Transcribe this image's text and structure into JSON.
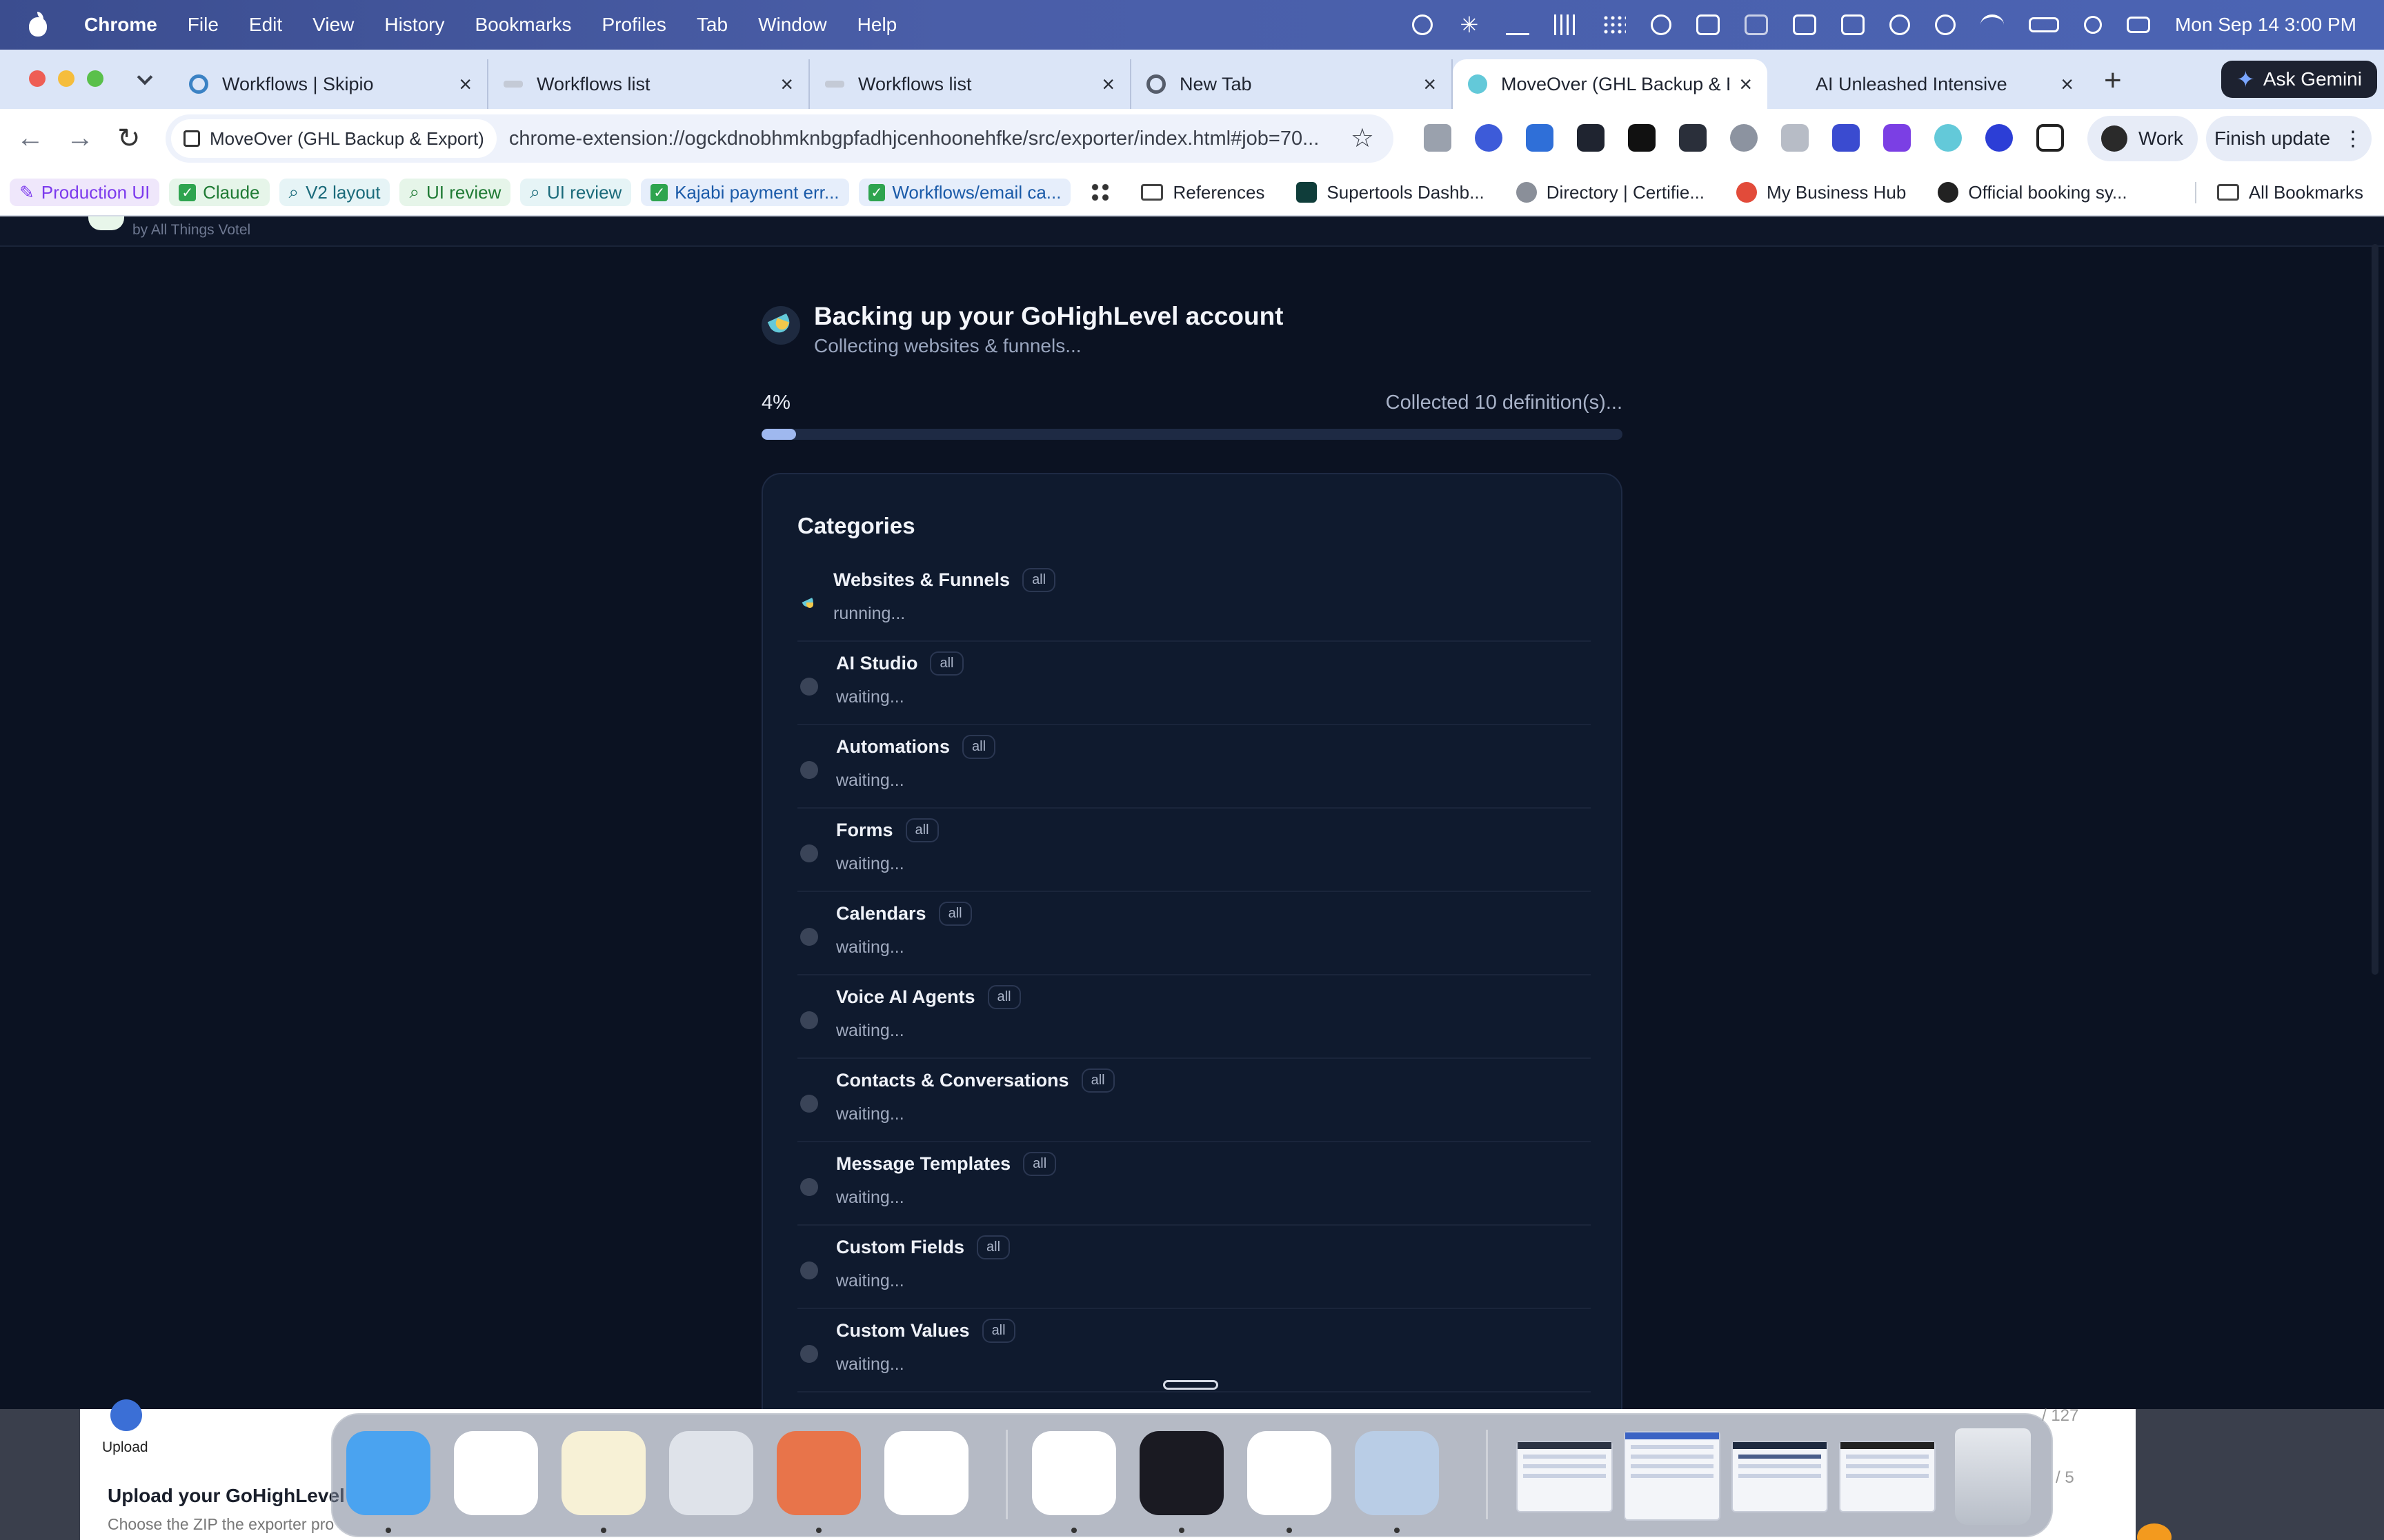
{
  "menubar": {
    "app_name": "Chrome",
    "items": [
      "File",
      "Edit",
      "View",
      "History",
      "Bookmarks",
      "Profiles",
      "Tab",
      "Window",
      "Help"
    ],
    "clock": "Mon Sep 14  3:00 PM"
  },
  "tabs": [
    {
      "title": "Workflows | Skipio",
      "favicon_color": "#3b82c4",
      "active": false
    },
    {
      "title": "Workflows list",
      "favicon_color": "#9aa3b5",
      "active": false
    },
    {
      "title": "Workflows list",
      "favicon_color": "#9aa3b5",
      "active": false
    },
    {
      "title": "New Tab",
      "favicon_color": "#555c6a",
      "active": false
    },
    {
      "title": "MoveOver (GHL Backup & E",
      "favicon_color": "#63c9d9",
      "active": true
    },
    {
      "title": "AI Unleashed Intensive",
      "favicon_color": "#ffffff",
      "active": false
    }
  ],
  "gemini_label": "Ask Gemini",
  "omnibox": {
    "chip": "MoveOver (GHL Backup & Export)",
    "url": "chrome-extension://ogckdnobhmknbgpfadhjcenhoonehfke/src/exporter/index.html#job=70..."
  },
  "profile_label": "Work",
  "update_label": "Finish update",
  "bookmarks": {
    "pills": [
      {
        "label": "Production UI",
        "icon": "pencil-icon",
        "color": "#7c3aed",
        "bg": "#efe7fb"
      },
      {
        "label": "Claude",
        "icon": "check-icon",
        "color": "#1f7a34",
        "bg": "#e6f5e9"
      },
      {
        "label": "V2 layout",
        "icon": "search-icon",
        "color": "#1a6a7a",
        "bg": "#e6f4f6"
      },
      {
        "label": "UI review",
        "icon": "search-icon",
        "color": "#1f7a34",
        "bg": "#e6f5e9"
      },
      {
        "label": "UI review",
        "icon": "search-icon",
        "color": "#1a6a7a",
        "bg": "#e6f4f6"
      },
      {
        "label": "Kajabi payment err...",
        "icon": "check-icon",
        "color": "#1a5aa8",
        "bg": "#e6eefb"
      },
      {
        "label": "Workflows/email ca...",
        "icon": "check-icon",
        "color": "#1a5aa8",
        "bg": "#e6eefb"
      }
    ],
    "plain": [
      {
        "label": "References",
        "icon": "folder-icon"
      },
      {
        "label": "Supertools Dashb...",
        "icon": "shield-icon"
      },
      {
        "label": "Directory | Certifie...",
        "icon": "person-icon"
      },
      {
        "label": "My Business Hub",
        "icon": "location-pin-icon"
      },
      {
        "label": "Official booking sy...",
        "icon": "globe-icon"
      }
    ],
    "all_bookmarks": "All Bookmarks"
  },
  "page": {
    "brand_byline": "by All Things Votel",
    "title": "Backing up your GoHighLevel account",
    "subtitle": "Collecting websites & funnels...",
    "progress_text": "4%",
    "progress_value": 0.04,
    "progress_status": "Collected 10 definition(s)...",
    "categories_heading": "Categories",
    "categories": [
      {
        "name": "Websites & Funnels",
        "badge": "all",
        "state": "running...",
        "running": true
      },
      {
        "name": "AI Studio",
        "badge": "all",
        "state": "waiting...",
        "running": false
      },
      {
        "name": "Automations",
        "badge": "all",
        "state": "waiting...",
        "running": false
      },
      {
        "name": "Forms",
        "badge": "all",
        "state": "waiting...",
        "running": false
      },
      {
        "name": "Calendars",
        "badge": "all",
        "state": "waiting...",
        "running": false
      },
      {
        "name": "Voice AI Agents",
        "badge": "all",
        "state": "waiting...",
        "running": false
      },
      {
        "name": "Contacts & Conversations",
        "badge": "all",
        "state": "waiting...",
        "running": false
      },
      {
        "name": "Message Templates",
        "badge": "all",
        "state": "waiting...",
        "running": false
      },
      {
        "name": "Custom Fields",
        "badge": "all",
        "state": "waiting...",
        "running": false
      },
      {
        "name": "Custom Values",
        "badge": "all",
        "state": "waiting...",
        "running": false
      }
    ]
  },
  "background_window": {
    "upload_label": "Upload",
    "heading": "Upload your GoHighLevel e",
    "sub": "Choose the ZIP the exporter pro",
    "count1": "/ 127",
    "count2": "/ 5"
  },
  "dock": {
    "apps": [
      {
        "name": "finder-icon",
        "color": "#4aa3f0"
      },
      {
        "name": "chrome-icon",
        "color": "#ffffff"
      },
      {
        "name": "notes-icon",
        "color": "#f7f1d6"
      },
      {
        "name": "launchpad-icon",
        "color": "#dfe3ea"
      },
      {
        "name": "claude-icon",
        "color": "#e8744a"
      },
      {
        "name": "slack-icon",
        "color": "#ffffff"
      },
      {
        "name": "chrome-icon",
        "color": "#ffffff"
      },
      {
        "name": "voice-memos-icon",
        "color": "#1a1a22"
      },
      {
        "name": "chatgpt-icon",
        "color": "#ffffff"
      },
      {
        "name": "preview-icon",
        "color": "#b9cde6"
      }
    ]
  }
}
